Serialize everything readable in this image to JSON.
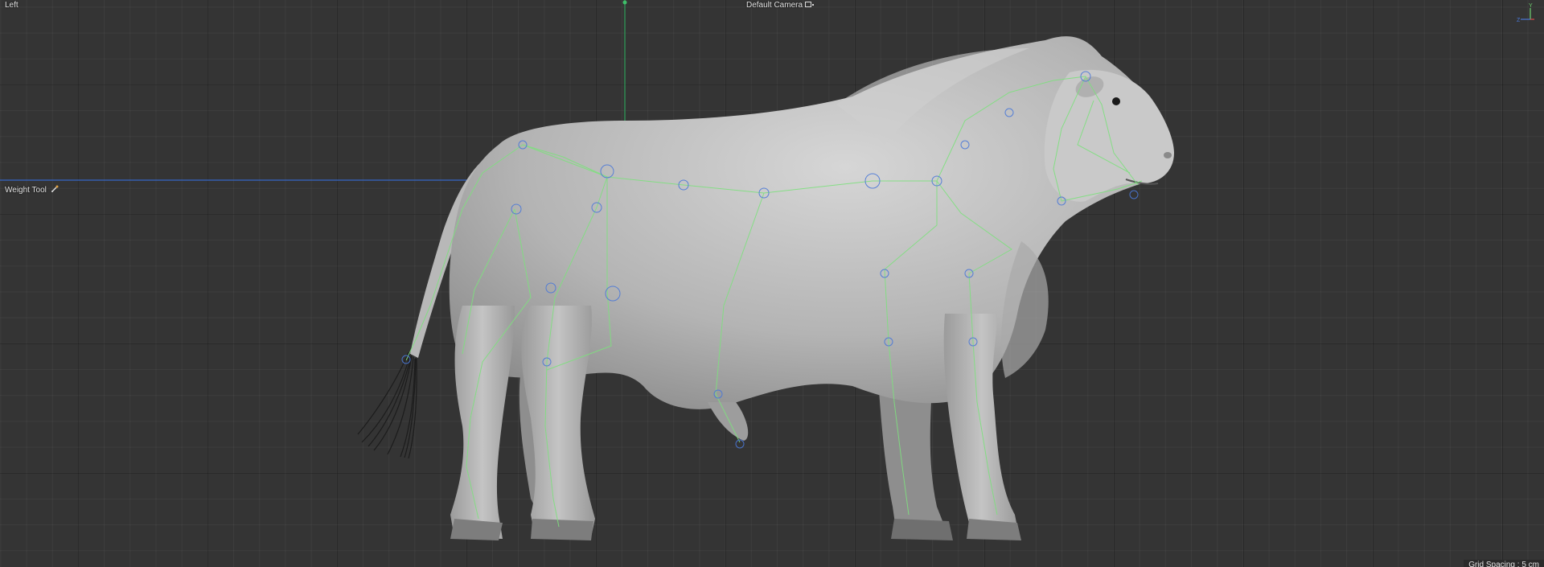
{
  "viewport": {
    "view_name": "Left",
    "camera": "Default Camera",
    "active_tool": "Weight Tool",
    "grid_spacing": "Grid Spacing : 5 cm"
  },
  "axis_widget": {
    "y_label": "Y",
    "z_label": "Z",
    "y_color": "#6fd16f",
    "z_color": "#4a78d8",
    "x_color": "#d84a4a"
  },
  "scene": {
    "object": "bull mesh",
    "rig_color": "#7ee07e",
    "mesh_color": "#bdbdbd",
    "world_y_axis_color": "#2e9e5a",
    "world_z_axis_color": "#3566c8"
  }
}
